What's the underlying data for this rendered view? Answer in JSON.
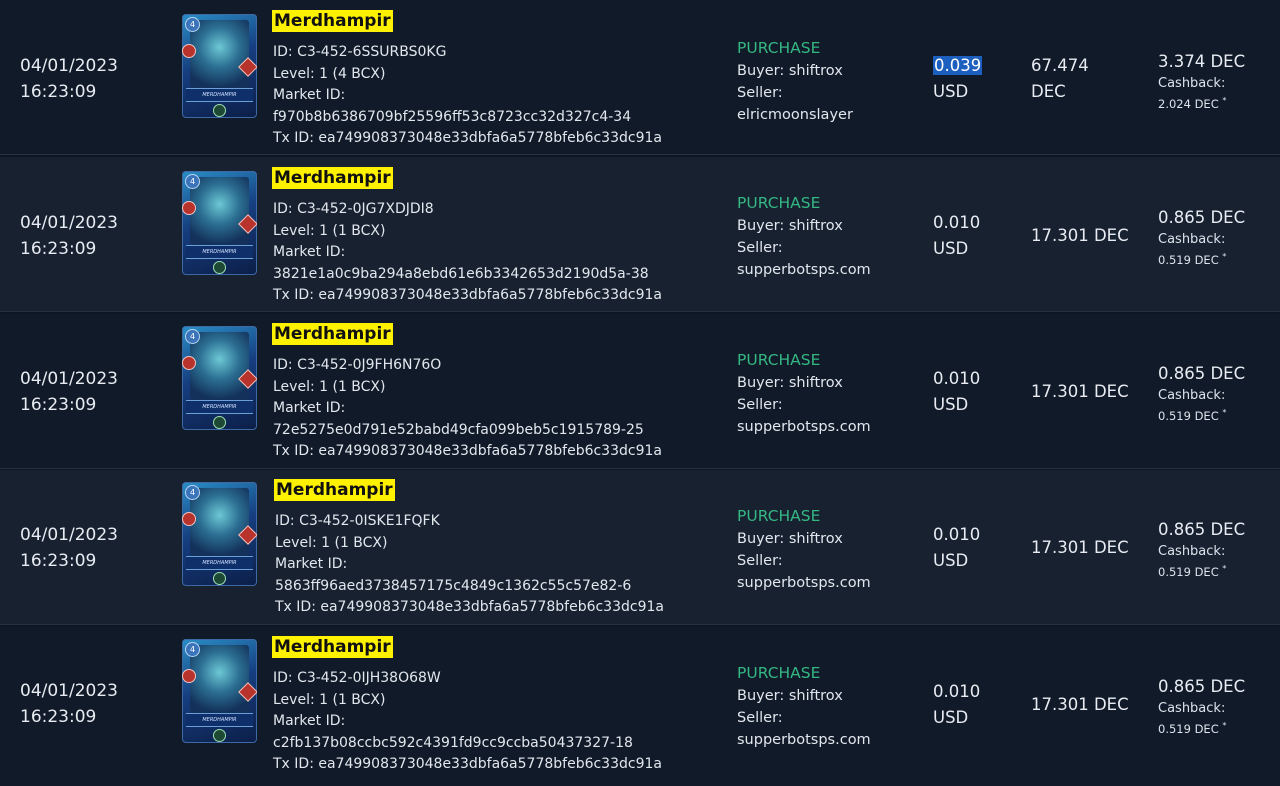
{
  "rows": [
    {
      "date": "04/01/2023",
      "time": "16:23:09",
      "card": {
        "name": "Merdhampir",
        "level_badge": "4",
        "banner": "MERDHAMPIR"
      },
      "id": "ID: C3-452-6SSURBS0KG",
      "level": "Level: 1 (4 BCX)",
      "market_label": "Market ID:",
      "market_id": "f970b8b6386709bf25596ff53c8723cc32d327c4-34",
      "tx_id": "Tx ID: ea749908373048e33dbfa6a5778bfeb6c33dc91a",
      "type": "PURCHASE",
      "buyer": "Buyer: shiftrox",
      "seller_label": "Seller:",
      "seller": "elricmoonslayer",
      "usd_value": "0.039",
      "usd_unit": "USD",
      "dec_value": "67.474",
      "dec_unit": "DEC",
      "amount": "3.374 DEC",
      "cashback_label": "Cashback:",
      "cashback": "2.024 DEC",
      "cashback_mark": "*"
    },
    {
      "date": "04/01/2023",
      "time": "16:23:09",
      "card": {
        "name": "Merdhampir",
        "level_badge": "4",
        "banner": "MERDHAMPIR"
      },
      "id": "ID: C3-452-0JG7XDJDI8",
      "level": "Level: 1 (1 BCX)",
      "market_label": "Market ID:",
      "market_id": "3821e1a0c9ba294a8ebd61e6b3342653d2190d5a-38",
      "tx_id": "Tx ID: ea749908373048e33dbfa6a5778bfeb6c33dc91a",
      "type": "PURCHASE",
      "buyer": "Buyer: shiftrox",
      "seller_label": "Seller:",
      "seller": "supperbotsps.com",
      "usd_value": "0.010",
      "usd_unit": "USD",
      "dec_value": "17.301 DEC",
      "dec_unit": "",
      "amount": "0.865 DEC",
      "cashback_label": "Cashback:",
      "cashback": "0.519 DEC",
      "cashback_mark": "*"
    },
    {
      "date": "04/01/2023",
      "time": "16:23:09",
      "card": {
        "name": "Merdhampir",
        "level_badge": "4",
        "banner": "MERDHAMPIR"
      },
      "id": "ID: C3-452-0J9FH6N76O",
      "level": "Level: 1 (1 BCX)",
      "market_label": "Market ID:",
      "market_id": "72e5275e0d791e52babd49cfa099beb5c1915789-25",
      "tx_id": "Tx ID: ea749908373048e33dbfa6a5778bfeb6c33dc91a",
      "type": "PURCHASE",
      "buyer": "Buyer: shiftrox",
      "seller_label": "Seller:",
      "seller": "supperbotsps.com",
      "usd_value": "0.010",
      "usd_unit": "USD",
      "dec_value": "17.301 DEC",
      "dec_unit": "",
      "amount": "0.865 DEC",
      "cashback_label": "Cashback:",
      "cashback": "0.519 DEC",
      "cashback_mark": "*"
    },
    {
      "date": "04/01/2023",
      "time": "16:23:09",
      "card": {
        "name": "Merdhampir",
        "level_badge": "4",
        "banner": "MERDHAMPIR"
      },
      "id": "ID: C3-452-0ISKE1FQFK",
      "level": "Level: 1 (1 BCX)",
      "market_label": "Market ID:",
      "market_id": "5863ff96aed3738457175c4849c1362c55c57e82-6",
      "tx_id": "Tx ID: ea749908373048e33dbfa6a5778bfeb6c33dc91a",
      "type": "PURCHASE",
      "buyer": "Buyer: shiftrox",
      "seller_label": "Seller:",
      "seller": "supperbotsps.com",
      "usd_value": "0.010",
      "usd_unit": "USD",
      "dec_value": "17.301 DEC",
      "dec_unit": "",
      "amount": "0.865 DEC",
      "cashback_label": "Cashback:",
      "cashback": "0.519 DEC",
      "cashback_mark": "*"
    },
    {
      "date": "04/01/2023",
      "time": "16:23:09",
      "card": {
        "name": "Merdhampir",
        "level_badge": "4",
        "banner": "MERDHAMPIR"
      },
      "id": "ID: C3-452-0IJH38O68W",
      "level": "Level: 1 (1 BCX)",
      "market_label": "Market ID:",
      "market_id": "c2fb137b08ccbc592c4391fd9cc9ccba50437327-18",
      "tx_id": "Tx ID: ea749908373048e33dbfa6a5778bfeb6c33dc91a",
      "type": "PURCHASE",
      "buyer": "Buyer: shiftrox",
      "seller_label": "Seller:",
      "seller": "supperbotsps.com",
      "usd_value": "0.010",
      "usd_unit": "USD",
      "dec_value": "17.301 DEC",
      "dec_unit": "",
      "amount": "0.865 DEC",
      "cashback_label": "Cashback:",
      "cashback": "0.519 DEC",
      "cashback_mark": "*"
    }
  ],
  "colors": {
    "background": "#0f1623",
    "row_alt": "#172130",
    "purchase_green": "#35b783",
    "name_highlight": "#fff200",
    "selection_blue": "#1d5fbf"
  }
}
